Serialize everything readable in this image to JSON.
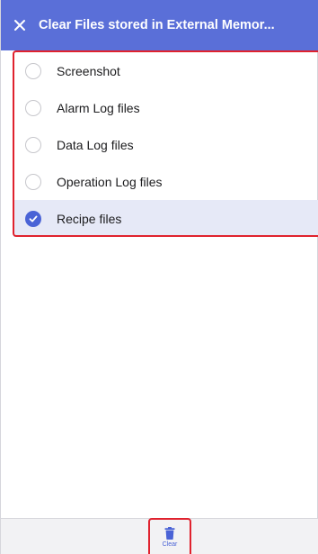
{
  "header": {
    "title": "Clear Files stored in External Memor...",
    "close_icon": "close-icon"
  },
  "list": {
    "items": [
      {
        "label": "Screenshot",
        "checked": false
      },
      {
        "label": "Alarm Log files",
        "checked": false
      },
      {
        "label": "Data Log files",
        "checked": false
      },
      {
        "label": "Operation Log files",
        "checked": false
      },
      {
        "label": "Recipe files",
        "checked": true
      }
    ]
  },
  "toolbar": {
    "clear_label": "Clear",
    "clear_icon": "trash-icon"
  },
  "colors": {
    "header_bg": "#5a6fd8",
    "accent": "#4a63d6",
    "selected_row_bg": "#e6e9f7",
    "highlight_border": "#e0222e"
  }
}
